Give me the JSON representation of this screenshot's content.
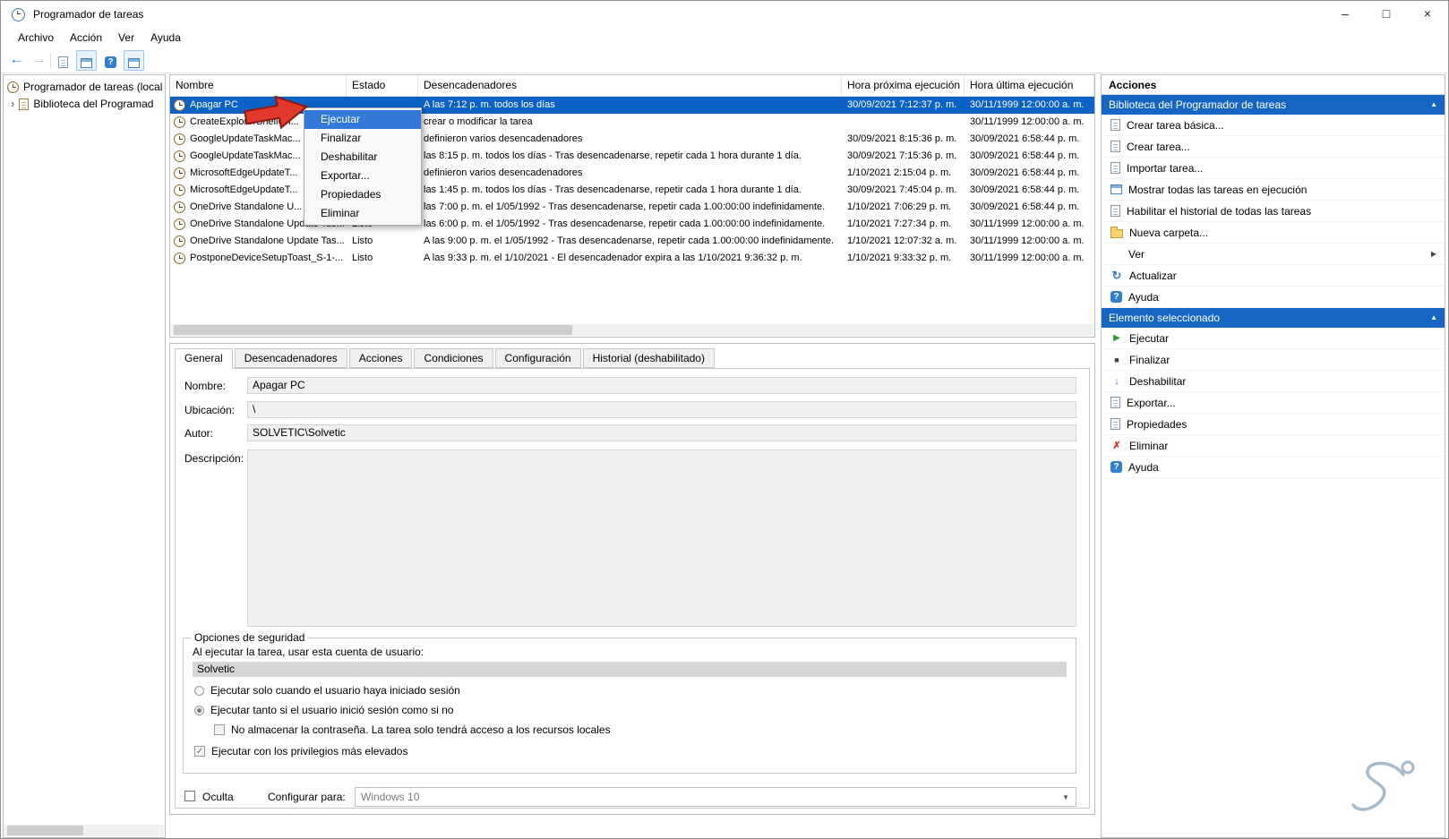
{
  "window": {
    "title": "Programador de tareas"
  },
  "colors": {
    "selection_blue": "#0d63c5",
    "section_header_blue": "#1866c4",
    "menu_highlight_blue": "#3579d8",
    "annotation_red": "#e2392b"
  },
  "icons": {
    "minimize": "–",
    "maximize": "□",
    "close": "×",
    "back": "←",
    "forward": "→",
    "chevron_up": "▲",
    "chevron_right": "▶",
    "tree_expander": "›",
    "dropdown": "▼",
    "check": "✓",
    "run": "▶",
    "end": "■",
    "disable": "↓",
    "delete": "✗",
    "refresh": "↻",
    "help": "?"
  },
  "menubar": {
    "items": [
      "Archivo",
      "Acción",
      "Ver",
      "Ayuda"
    ]
  },
  "tree": {
    "root": "Programador de tareas (local",
    "child": "Biblioteca del Programad"
  },
  "task_table": {
    "columns": [
      "Nombre",
      "Estado",
      "Desencadenadores",
      "Hora próxima ejecución",
      "Hora última ejecución"
    ],
    "rows": [
      {
        "name": "Apagar PC",
        "estado": "",
        "triggers": "A las 7:12 p. m. todos los días",
        "next": "30/09/2021 7:12:37 p. m.",
        "last": "30/11/1999 12:00:00 a. m.",
        "selected": true
      },
      {
        "name": "CreateExplorerShellUn...",
        "estado": "",
        "triggers": "crear o modificar la tarea",
        "next": "",
        "last": "30/11/1999 12:00:00 a. m."
      },
      {
        "name": "GoogleUpdateTaskMac...",
        "estado": "",
        "triggers": "definieron varios desencadenadores",
        "next": "30/09/2021 8:15:36 p. m.",
        "last": "30/09/2021 6:58:44 p. m."
      },
      {
        "name": "GoogleUpdateTaskMac...",
        "estado": "",
        "triggers": "las 8:15 p. m. todos los días - Tras desencadenarse, repetir cada 1 hora durante 1 día.",
        "next": "30/09/2021 7:15:36 p. m.",
        "last": "30/09/2021 6:58:44 p. m."
      },
      {
        "name": "MicrosoftEdgeUpdateT...",
        "estado": "",
        "triggers": "definieron varios desencadenadores",
        "next": "1/10/2021 2:15:04 p. m.",
        "last": "30/09/2021 6:58:44 p. m."
      },
      {
        "name": "MicrosoftEdgeUpdateT...",
        "estado": "",
        "triggers": "las 1:45 p. m. todos los días - Tras desencadenarse, repetir cada 1 hora durante 1 día.",
        "next": "30/09/2021 7:45:04 p. m.",
        "last": "30/09/2021 6:58:44 p. m."
      },
      {
        "name": "OneDrive Standalone U...",
        "estado": "",
        "triggers": "las 7:00 p. m. el 1/05/1992 - Tras desencadenarse, repetir cada 1.00:00:00 indefinidamente.",
        "next": "1/10/2021 7:06:29 p. m.",
        "last": "30/09/2021 6:58:44 p. m."
      },
      {
        "name": "OneDrive Standalone Update Tas...",
        "estado": "Listo",
        "triggers": "las 6:00 p. m. el 1/05/1992 - Tras desencadenarse, repetir cada 1.00:00:00 indefinidamente.",
        "next": "1/10/2021 7:27:34 p. m.",
        "last": "30/11/1999 12:00:00 a. m."
      },
      {
        "name": "OneDrive Standalone Update Tas...",
        "estado": "Listo",
        "triggers": "A las 9:00 p. m. el 1/05/1992 - Tras desencadenarse, repetir cada 1.00:00:00 indefinidamente.",
        "next": "1/10/2021 12:07:32 a. m.",
        "last": "30/11/1999 12:00:00 a. m."
      },
      {
        "name": "PostponeDeviceSetupToast_S-1-...",
        "estado": "Listo",
        "triggers": "A las 9:33 p. m. el 1/10/2021 - El desencadenador expira a las 1/10/2021 9:36:32 p. m.",
        "next": "1/10/2021 9:33:32 p. m.",
        "last": "30/11/1999 12:00:00 a. m."
      }
    ]
  },
  "context_menu": {
    "items": [
      {
        "label": "Ejecutar",
        "highlighted": true
      },
      {
        "label": "Finalizar"
      },
      {
        "label": "Deshabilitar"
      },
      {
        "label": "Exportar..."
      },
      {
        "label": "Propiedades"
      },
      {
        "label": "Eliminar"
      }
    ]
  },
  "details": {
    "tabs": [
      {
        "label": "General",
        "active": true
      },
      {
        "label": "Desencadenadores"
      },
      {
        "label": "Acciones"
      },
      {
        "label": "Condiciones"
      },
      {
        "label": "Configuración"
      },
      {
        "label": "Historial (deshabilitado)"
      }
    ],
    "general": {
      "name_label": "Nombre:",
      "name_value": "Apagar PC",
      "location_label": "Ubicación:",
      "location_value": "\\",
      "author_label": "Autor:",
      "author_value": "SOLVETIC\\Solvetic",
      "description_label": "Descripción:",
      "description_value": ""
    },
    "security": {
      "title": "Opciones de seguridad",
      "account_line": "Al ejecutar la tarea, usar esta cuenta de usuario:",
      "account_value": "Solvetic",
      "radio_logged_on": "Ejecutar solo cuando el usuario haya iniciado sesión",
      "radio_any": "Ejecutar tanto si el usuario inició sesión como si no",
      "check_no_password": "No almacenar la contraseña. La tarea solo tendrá acceso a los recursos locales",
      "check_highest": "Ejecutar con los privilegios más elevados"
    },
    "footer": {
      "hidden_label": "Oculta",
      "configure_label": "Configurar para:",
      "configure_value": "Windows 10"
    }
  },
  "actions_panel": {
    "title": "Acciones",
    "sections": [
      {
        "header": "Biblioteca del Programador de tareas",
        "items": [
          {
            "icon": "create-basic-task-icon",
            "label": "Crear tarea básica..."
          },
          {
            "icon": "create-task-icon",
            "label": "Crear tarea..."
          },
          {
            "icon": "import-task-icon",
            "label": "Importar tarea..."
          },
          {
            "icon": "show-running-tasks-icon",
            "label": "Mostrar todas las tareas en ejecución"
          },
          {
            "icon": "enable-history-icon",
            "label": "Habilitar el historial de todas las tareas"
          },
          {
            "icon": "new-folder-icon",
            "label": "Nueva carpeta..."
          },
          {
            "icon": "",
            "label": "Ver",
            "submenu": true
          },
          {
            "icon": "refresh-icon",
            "label": "Actualizar"
          },
          {
            "icon": "help-icon",
            "label": "Ayuda"
          }
        ]
      },
      {
        "header": "Elemento seleccionado",
        "items": [
          {
            "icon": "run-icon",
            "label": "Ejecutar"
          },
          {
            "icon": "end-icon",
            "label": "Finalizar"
          },
          {
            "icon": "disable-icon",
            "label": "Deshabilitar"
          },
          {
            "icon": "export-icon",
            "label": "Exportar..."
          },
          {
            "icon": "properties-icon",
            "label": "Propiedades"
          },
          {
            "icon": "delete-icon",
            "label": "Eliminar"
          },
          {
            "icon": "help-icon",
            "label": "Ayuda"
          }
        ]
      }
    ]
  }
}
